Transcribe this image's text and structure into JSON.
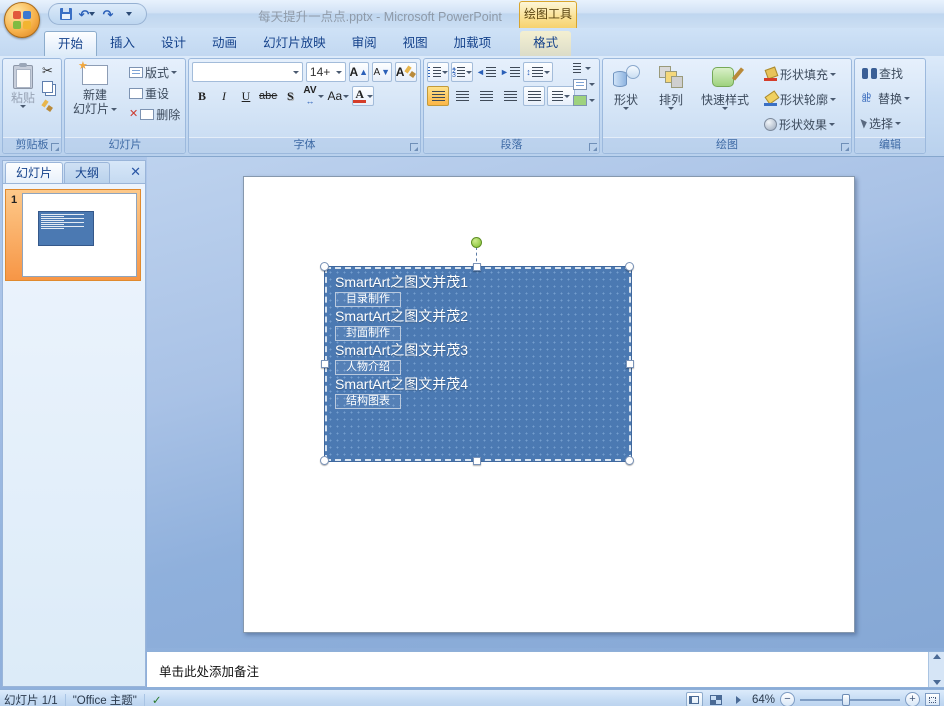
{
  "window": {
    "title": "每天提升一点点.pptx - Microsoft PowerPoint",
    "context_tool_header": "绘图工具"
  },
  "icons": {
    "scissors": "✂",
    "undo": "↶",
    "redo": "↷",
    "close": "✕",
    "delete_x": "✕",
    "check": "✓"
  },
  "tabs": [
    {
      "label": "开始"
    },
    {
      "label": "插入"
    },
    {
      "label": "设计"
    },
    {
      "label": "动画"
    },
    {
      "label": "幻灯片放映"
    },
    {
      "label": "审阅"
    },
    {
      "label": "视图"
    },
    {
      "label": "加载项"
    },
    {
      "label": "格式"
    }
  ],
  "ribbon": {
    "clipboard": {
      "group_label": "剪贴板",
      "paste": "粘贴"
    },
    "slides": {
      "group_label": "幻灯片",
      "new_slide_line1": "新建",
      "new_slide_line2": "幻灯片",
      "layout": "版式",
      "reset": "重设",
      "delete": "删除"
    },
    "font": {
      "group_label": "字体",
      "font_size": "14+",
      "bold": "B",
      "italic": "I",
      "underline": "U",
      "strikethrough": "abe",
      "shadow": "S",
      "spacing": "AV",
      "change_case": "Aa",
      "font_color": "A",
      "grow": "A",
      "shrink": "A",
      "clear": "A"
    },
    "paragraph": {
      "group_label": "段落"
    },
    "drawing": {
      "group_label": "绘图",
      "shapes": "形状",
      "arrange": "排列",
      "quick_styles": "快速样式",
      "shape_fill": "形状填充",
      "shape_outline": "形状轮廓",
      "shape_effects": "形状效果"
    },
    "editing": {
      "group_label": "编辑",
      "find": "查找",
      "replace": "替换",
      "select": "选择"
    }
  },
  "slides_panel": {
    "slides_tab": "幻灯片",
    "outline_tab": "大纲",
    "slide_number": "1"
  },
  "slide": {
    "items": [
      {
        "title": "SmartArt之图文并茂1",
        "sub": "目录制作"
      },
      {
        "title": "SmartArt之图文并茂2",
        "sub": "封面制作"
      },
      {
        "title": "SmartArt之图文并茂3",
        "sub": "人物介绍"
      },
      {
        "title": "SmartArt之图文并茂4",
        "sub": "结构图表"
      }
    ]
  },
  "notes": {
    "placeholder": "单击此处添加备注"
  },
  "status_bar": {
    "slide_info": "幻灯片 1/1",
    "theme": "\"Office 主题\"",
    "zoom_level": "64%"
  },
  "colors": {
    "accent_blue": "#4b79b2",
    "selection_orange": "#f79646",
    "context_amber": "#fbe296"
  }
}
